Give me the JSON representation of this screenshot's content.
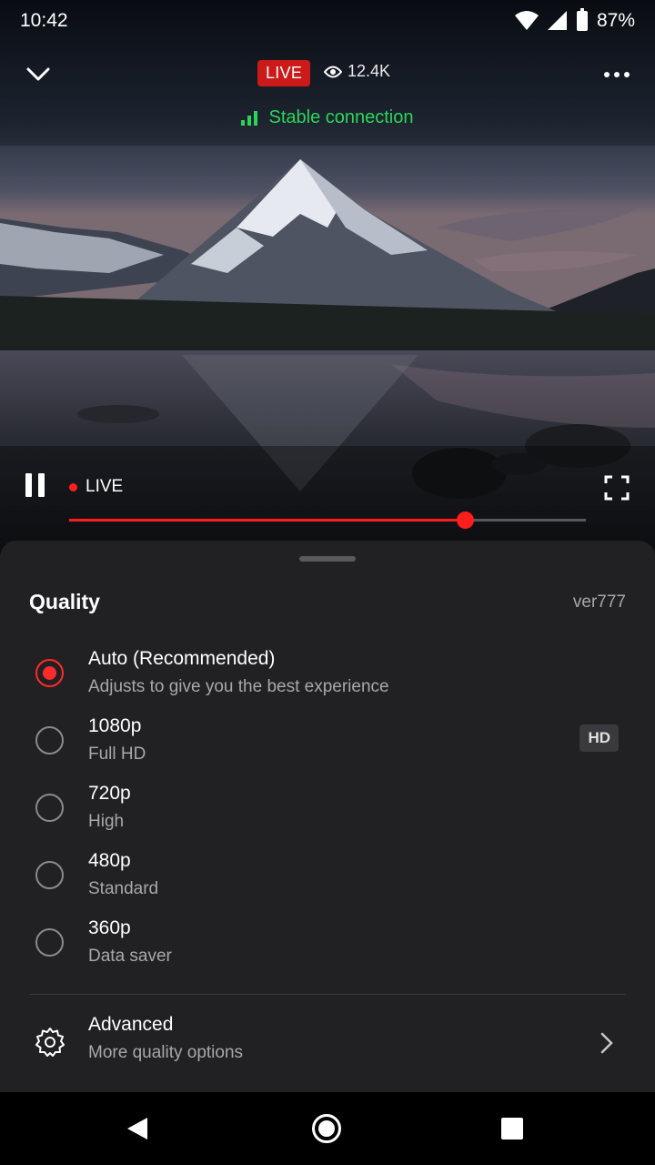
{
  "status_bar": {
    "time": "10:42",
    "battery": "87%"
  },
  "player": {
    "live_badge": "LIVE",
    "viewer_count": "12.4K",
    "connection_status": "Stable connection",
    "live_label": "LIVE",
    "progress_fraction": 0.766
  },
  "quality_sheet": {
    "title": "Quality",
    "version": "ver777",
    "options": [
      {
        "label": "Auto (Recommended)",
        "sub": "Adjusts to give you the best experience",
        "selected": true
      },
      {
        "label": "1080p",
        "sub": "Full HD",
        "badge": "HD",
        "selected": false
      },
      {
        "label": "720p",
        "sub": "High",
        "selected": false
      },
      {
        "label": "480p",
        "sub": "Standard",
        "selected": false
      },
      {
        "label": "360p",
        "sub": "Data saver",
        "selected": false
      }
    ],
    "advanced": {
      "label": "Advanced",
      "sub": "More quality options"
    }
  },
  "colors": {
    "accent": "#ff1d1d",
    "connection": "#2dd45a",
    "sheet_bg": "#212124"
  }
}
